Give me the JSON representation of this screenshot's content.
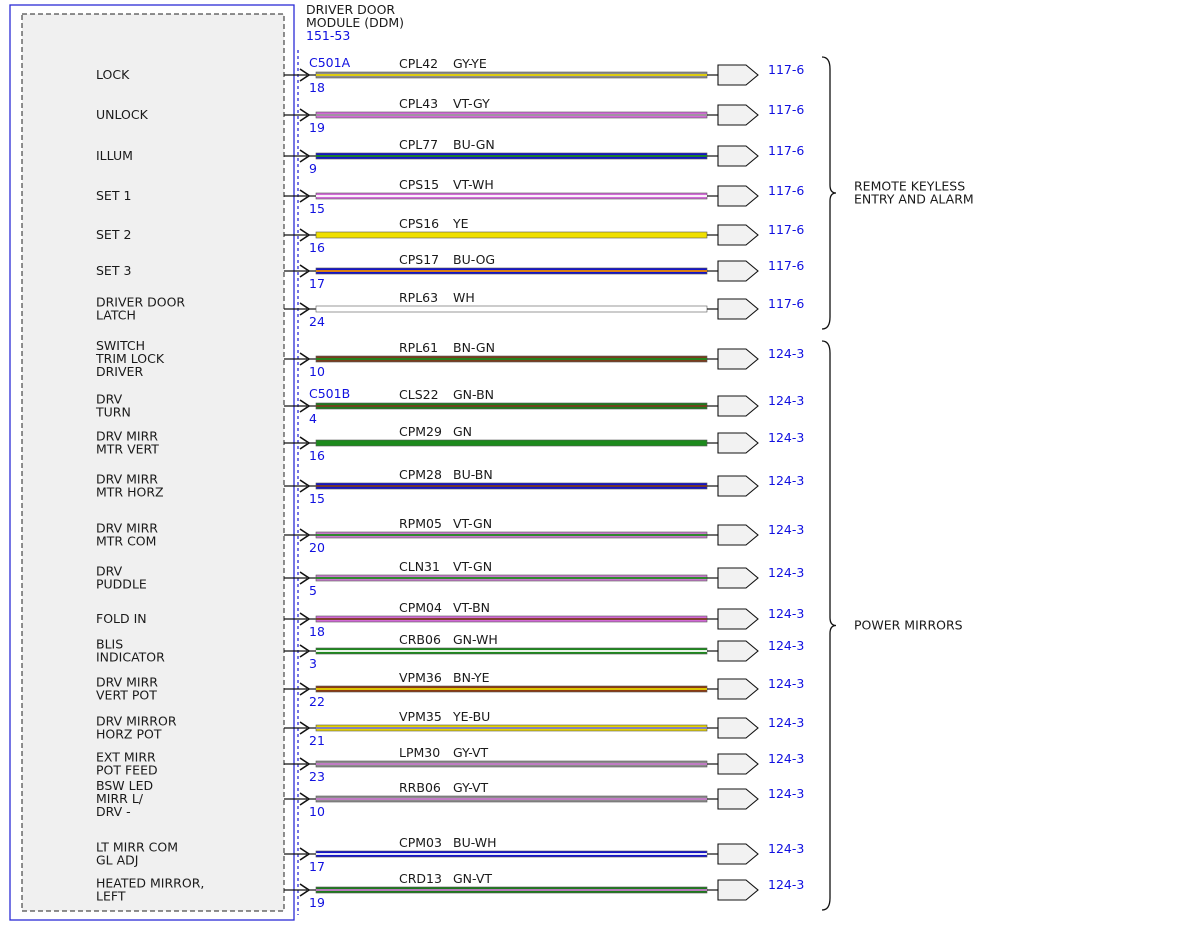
{
  "module": {
    "title_line1": "DRIVER DOOR",
    "title_line2": "MODULE (DDM)",
    "code": "151-53"
  },
  "connectors": [
    "C501A",
    "C501B"
  ],
  "pins": [
    {
      "label": [
        "LOCK"
      ],
      "pin": "18",
      "circuit": "CPL42",
      "color_code": "GY-YE",
      "ref": "117-6",
      "base": "#8c8c8c",
      "stripe": "#e6d300",
      "connector": "C501A"
    },
    {
      "label": [
        "UNLOCK"
      ],
      "pin": "19",
      "circuit": "CPL43",
      "color_code": "VT-GY",
      "ref": "117-6",
      "base": "#d26bd6",
      "stripe": "#9a9a9a"
    },
    {
      "label": [
        "ILLUM"
      ],
      "pin": "9",
      "circuit": "CPL77",
      "color_code": "BU-GN",
      "ref": "117-6",
      "base": "#1414c8",
      "stripe": "#1d8a1d"
    },
    {
      "label": [
        "SET 1"
      ],
      "pin": "15",
      "circuit": "CPS15",
      "color_code": "VT-WH",
      "ref": "117-6",
      "base": "#d26bd6",
      "stripe": "#ffffff"
    },
    {
      "label": [
        "SET 2"
      ],
      "pin": "16",
      "circuit": "CPS16",
      "color_code": "YE",
      "ref": "117-6",
      "base": "#f0e000",
      "stripe": ""
    },
    {
      "label": [
        "SET 3"
      ],
      "pin": "17",
      "circuit": "CPS17",
      "color_code": "BU-OG",
      "ref": "117-6",
      "base": "#1414c8",
      "stripe": "#f08c00"
    },
    {
      "label": [
        "DRIVER DOOR",
        "LATCH"
      ],
      "pin": "24",
      "circuit": "RPL63",
      "color_code": "WH",
      "ref": "117-6",
      "base": "#ffffff",
      "stripe": ""
    },
    {
      "label": [
        "SWITCH",
        "TRIM LOCK",
        "DRIVER"
      ],
      "pin": "10",
      "circuit": "RPL61",
      "color_code": "BN-GN",
      "ref": "124-3",
      "base": "#7a3c1e",
      "stripe": "#1d8a1d"
    },
    {
      "label": [
        "DRV",
        "TURN"
      ],
      "pin": "4",
      "circuit": "CLS22",
      "color_code": "GN-BN",
      "ref": "124-3",
      "base": "#1d7a1d",
      "stripe": "#7a3c1e",
      "connector": "C501B"
    },
    {
      "label": [
        "DRV MIRR",
        "MTR VERT"
      ],
      "pin": "16",
      "circuit": "CPM29",
      "color_code": "GN",
      "ref": "124-3",
      "base": "#1d8a1d",
      "stripe": ""
    },
    {
      "label": [
        "DRV MIRR",
        "MTR HORZ"
      ],
      "pin": "15",
      "circuit": "CPM28",
      "color_code": "BU-BN",
      "ref": "124-3",
      "base": "#1414c8",
      "stripe": "#7a3c1e"
    },
    {
      "label": [
        "DRV MIRR",
        "MTR COM"
      ],
      "pin": "20",
      "circuit": "RPM05",
      "color_code": "VT-GN",
      "ref": "124-3",
      "base": "#c77acb",
      "stripe": "#1d8a1d"
    },
    {
      "label": [
        "DRV",
        "PUDDLE"
      ],
      "pin": "5",
      "circuit": "CLN31",
      "color_code": "VT-GN",
      "ref": "124-3",
      "base": "#c77acb",
      "stripe": "#1d8a1d"
    },
    {
      "label": [
        "FOLD IN"
      ],
      "pin": "18",
      "circuit": "CPM04",
      "color_code": "VT-BN",
      "ref": "124-3",
      "base": "#d26bd6",
      "stripe": "#7a3c1e"
    },
    {
      "label": [
        "BLIS",
        "INDICATOR"
      ],
      "pin": "3",
      "circuit": "CRB06",
      "color_code": "GN-WH",
      "ref": "124-3",
      "base": "#1d8a1d",
      "stripe": "#ffffff"
    },
    {
      "label": [
        "DRV MIRR",
        "VERT POT"
      ],
      "pin": "22",
      "circuit": "VPM36",
      "color_code": "BN-YE",
      "ref": "124-3",
      "base": "#8b3a12",
      "stripe": "#e6d300"
    },
    {
      "label": [
        "DRV MIRROR",
        "HORZ POT"
      ],
      "pin": "21",
      "circuit": "VPM35",
      "color_code": "YE-BU",
      "ref": "124-3",
      "base": "#e6d300",
      "stripe": "#7a7ad0"
    },
    {
      "label": [
        "EXT MIRR",
        "POT FEED"
      ],
      "pin": "23",
      "circuit": "LPM30",
      "color_code": "GY-VT",
      "ref": "124-3",
      "base": "#8c8c8c",
      "stripe": "#c77acb"
    },
    {
      "label": [
        "BSW LED",
        "MIRR L/",
        "DRV -"
      ],
      "pin": "10",
      "circuit": "RRB06",
      "color_code": "GY-VT",
      "ref": "124-3",
      "base": "#8c8c8c",
      "stripe": "#c77acb"
    },
    {
      "label": [
        "LT MIRR COM",
        "GL ADJ"
      ],
      "pin": "17",
      "circuit": "CPM03",
      "color_code": "BU-WH",
      "ref": "124-3",
      "base": "#1414c8",
      "stripe": "#ffffff"
    },
    {
      "label": [
        "HEATED MIRROR,",
        "LEFT"
      ],
      "pin": "19",
      "circuit": "CRD13",
      "color_code": "GN-VT",
      "ref": "124-3",
      "base": "#1d7a1d",
      "stripe": "#c77acb"
    }
  ],
  "groups": [
    {
      "label": [
        "REMOTE KEYLESS",
        "ENTRY AND ALARM"
      ],
      "from": 0,
      "to": 6
    },
    {
      "label": [
        "POWER MIRRORS"
      ],
      "from": 7,
      "to": 20
    }
  ],
  "colors": {
    "accent_blue": "#1010e0",
    "module_fill": "#f0f0f0",
    "module_border": "#2b2bd6"
  }
}
